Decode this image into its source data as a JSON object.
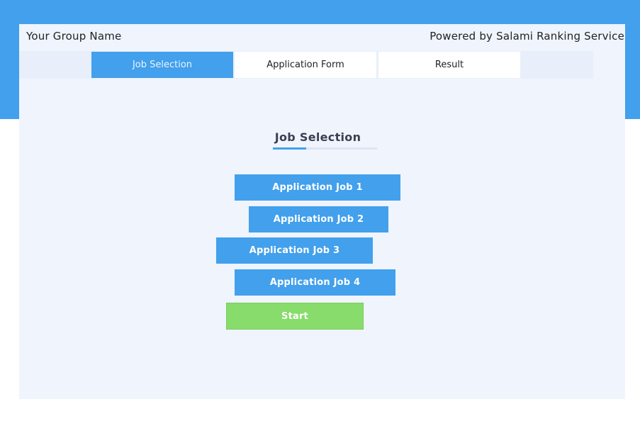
{
  "header": {
    "group_name": "Your Group Name",
    "powered_by": "Powered by Salami Ranking Service"
  },
  "tabs": [
    {
      "label": "Job Selection",
      "active": true
    },
    {
      "label": "Application Form",
      "active": false
    },
    {
      "label": "Result",
      "active": false
    }
  ],
  "main": {
    "section_title": "Job Selection",
    "jobs": [
      {
        "label": "Application Job 1"
      },
      {
        "label": "Application Job 2"
      },
      {
        "label": "Application Job 3"
      },
      {
        "label": "Application Job 4"
      }
    ],
    "start_label": "Start"
  },
  "colors": {
    "primary": "#42a0ec",
    "start": "#88dc6b",
    "card_background": "#eff4fd"
  }
}
